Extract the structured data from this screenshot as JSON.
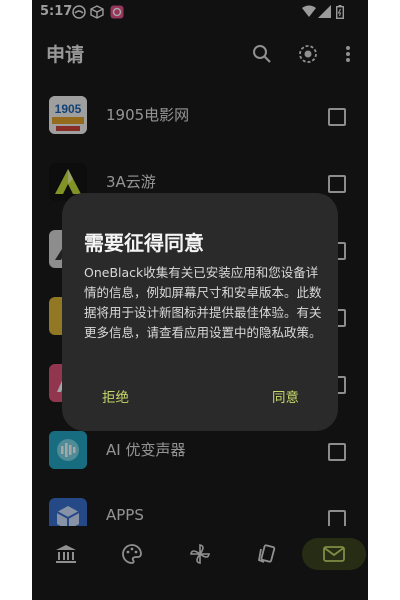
{
  "status": {
    "time": "5:17"
  },
  "appbar": {
    "title": "申请"
  },
  "apps": [
    {
      "name": "1905电影网",
      "icon": "1905-movie-icon",
      "icon_text": "1905"
    },
    {
      "name": "3A云游",
      "icon": "3a-cloud-game-icon"
    },
    {
      "name": "",
      "icon": "app-icon-3"
    },
    {
      "name": "",
      "icon": "app-icon-4"
    },
    {
      "name": "",
      "icon": "app-icon-5"
    },
    {
      "name": "AI 优变声器",
      "icon": "ai-voice-changer-icon"
    },
    {
      "name": "APPS",
      "icon": "apps-icon"
    }
  ],
  "dialog": {
    "title": "需要征得同意",
    "body": "OneBlack收集有关已安装应用和您设备详情的信息，例如屏幕尺寸和安卓版本。此数据将用于设计新图标并提供最佳体验。有关更多信息，请查看应用设置中的隐私政策。",
    "decline": "拒绝",
    "accept": "同意"
  },
  "nav": [
    {
      "icon": "bank-icon",
      "active": false
    },
    {
      "icon": "palette-icon",
      "active": false
    },
    {
      "icon": "pinwheel-icon",
      "active": false
    },
    {
      "icon": "cards-icon",
      "active": false
    },
    {
      "icon": "mail-icon",
      "active": true
    }
  ],
  "colors": {
    "background": "#1b1b1b",
    "dialog": "#2a2a2a",
    "accent": "#c8d86a",
    "nav_active": "#3c4521"
  }
}
